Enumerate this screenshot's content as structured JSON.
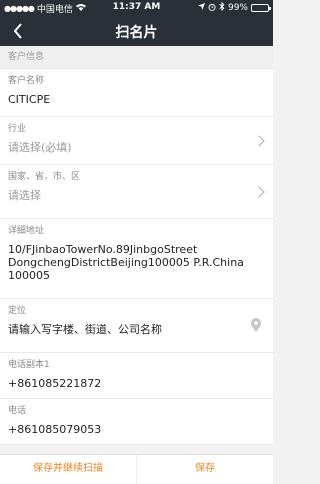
{
  "status_bar": {
    "carrier": "中国电信",
    "time": "11:37 AM",
    "battery": "99%",
    "battery_level": 0.99
  },
  "nav": {
    "title": "扫名片"
  },
  "section": {
    "title": "客户信息"
  },
  "fields": {
    "customer_name": {
      "label": "客户名称",
      "value": "CITICPE"
    },
    "industry": {
      "label": "行业",
      "placeholder": "请选择(必填)"
    },
    "region": {
      "label": "国家、省、市、区",
      "placeholder": "请选择"
    },
    "address": {
      "label": "详细地址",
      "value": "10/FJinbaoTowerNo.89JinbgoStreet DongchengDistrictBeijing100005 P.R.China 100005"
    },
    "location": {
      "label": "定位",
      "value": "请输入写字楼、街道、公司名称"
    },
    "phone_copy": {
      "label": "电话副本1",
      "value": "+861085221872"
    },
    "phone": {
      "label": "电话",
      "value": "+861085079053"
    }
  },
  "bottom_bar": {
    "save_continue": "保存并继续扫描",
    "save": "保存"
  },
  "colors": {
    "accent": "#f58220",
    "nav_bg": "#2b2f38"
  }
}
